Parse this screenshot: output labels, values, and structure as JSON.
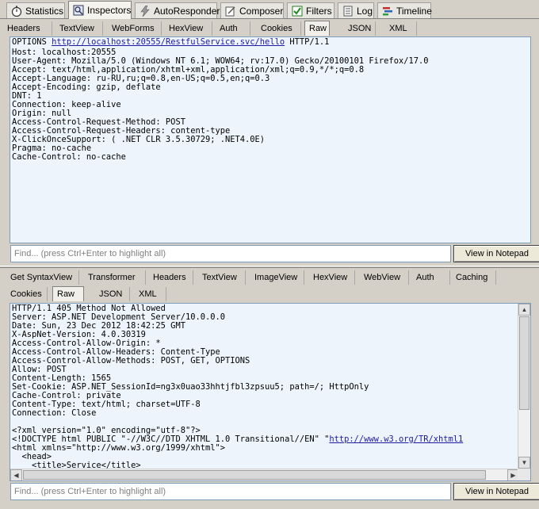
{
  "top_tabs": [
    {
      "label": "Statistics",
      "icon": "stopwatch-icon"
    },
    {
      "label": "Inspectors",
      "icon": "inspectors-icon"
    },
    {
      "label": "AutoResponder",
      "icon": "lightning-icon"
    },
    {
      "label": "Composer",
      "icon": "composer-icon"
    },
    {
      "label": "Filters",
      "icon": "checkbox-icon"
    },
    {
      "label": "Log",
      "icon": "log-icon"
    },
    {
      "label": "Timeline",
      "icon": "timeline-icon"
    }
  ],
  "request": {
    "tabs": [
      "Headers",
      "TextView",
      "WebForms",
      "HexView",
      "Auth",
      "Cookies",
      "Raw",
      "JSON",
      "XML"
    ],
    "active_tab": "Raw",
    "first_line": {
      "method": "OPTIONS",
      "url": "http://localhost:20555/RestfulService.svc/hello",
      "version": "HTTP/1.1"
    },
    "lines": [
      "Host: localhost:20555",
      "User-Agent: Mozilla/5.0 (Windows NT 6.1; WOW64; rv:17.0) Gecko/20100101 Firefox/17.0",
      "Accept: text/html,application/xhtml+xml,application/xml;q=0.9,*/*;q=0.8",
      "Accept-Language: ru-RU,ru;q=0.8,en-US;q=0.5,en;q=0.3",
      "Accept-Encoding: gzip, deflate",
      "DNT: 1",
      "Connection: keep-alive",
      "Origin: null",
      "Access-Control-Request-Method: POST",
      "Access-Control-Request-Headers: content-type",
      "X-ClickOnceSupport: ( .NET CLR 3.5.30729; .NET4.0E)",
      "Pragma: no-cache",
      "Cache-Control: no-cache"
    ],
    "find_placeholder": "Find... (press Ctrl+Enter to highlight all)",
    "notepad_button": "View in Notepad"
  },
  "response": {
    "tabs_row1": [
      "Get SyntaxView",
      "Transformer",
      "Headers",
      "TextView",
      "ImageView",
      "HexView",
      "WebView",
      "Auth",
      "Caching"
    ],
    "tabs_row2": [
      "Cookies",
      "Raw",
      "JSON",
      "XML"
    ],
    "active_tab": "Raw",
    "lines": [
      "HTTP/1.1 405 Method Not Allowed",
      "Server: ASP.NET Development Server/10.0.0.0",
      "Date: Sun, 23 Dec 2012 18:42:25 GMT",
      "X-AspNet-Version: 4.0.30319",
      "Access-Control-Allow-Origin: *",
      "Access-Control-Allow-Headers: Content-Type",
      "Access-Control-Allow-Methods: POST, GET, OPTIONS",
      "Allow: POST",
      "Content-Length: 1565",
      "Set-Cookie: ASP.NET_SessionId=ng3x0uao33hhtjfbl3zpsuu5; path=/; HttpOnly",
      "Cache-Control: private",
      "Content-Type: text/html; charset=UTF-8",
      "Connection: Close",
      "",
      "<?xml version=\"1.0\" encoding=\"utf-8\"?>"
    ],
    "doctype_prefix": "<!DOCTYPE html PUBLIC \"-//W3C//DTD XHTML 1.0 Transitional//EN\" \"",
    "doctype_link": "http://www.w3.org/TR/xhtml1",
    "body_lines": [
      "<html xmlns=\"http://www.w3.org/1999/xhtml\">",
      "  <head>",
      "    <title>Service</title>"
    ],
    "find_placeholder": "Find... (press Ctrl+Enter to highlight all)",
    "notepad_button": "View in Notepad"
  }
}
